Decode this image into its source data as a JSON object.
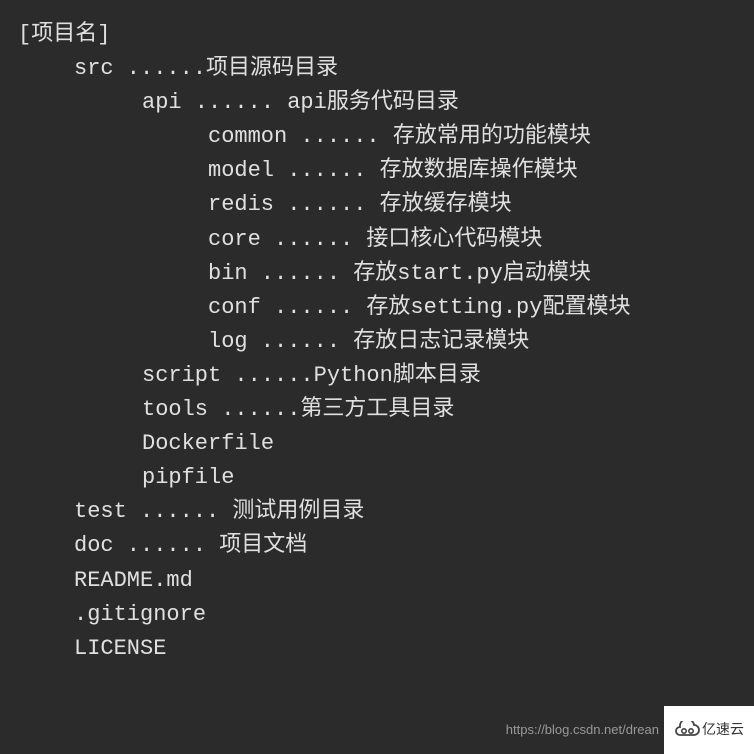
{
  "tree": {
    "root": "[项目名]",
    "lines": [
      {
        "indent": 1,
        "text": "src ......项目源码目录"
      },
      {
        "indent": 2,
        "text": "api ...... api服务代码目录"
      },
      {
        "indent": 3,
        "text": "common ...... 存放常用的功能模块"
      },
      {
        "indent": 3,
        "text": "model ...... 存放数据库操作模块"
      },
      {
        "indent": 3,
        "text": "redis ...... 存放缓存模块"
      },
      {
        "indent": 3,
        "text": "core ...... 接口核心代码模块"
      },
      {
        "indent": 3,
        "text": "bin ...... 存放start.py启动模块"
      },
      {
        "indent": 3,
        "text": "conf ...... 存放setting.py配置模块"
      },
      {
        "indent": 3,
        "text": "log ...... 存放日志记录模块"
      },
      {
        "indent": 2,
        "text": "script ......Python脚本目录"
      },
      {
        "indent": 2,
        "text": "tools ......第三方工具目录"
      },
      {
        "indent": 2,
        "text": "Dockerfile"
      },
      {
        "indent": 2,
        "text": "pipfile"
      },
      {
        "indent": 1,
        "text": "test ...... 测试用例目录"
      },
      {
        "indent": 1,
        "text": "doc ...... 项目文档"
      },
      {
        "indent": 1,
        "text": "README.md"
      },
      {
        "indent": 1,
        "text": ".gitignore"
      },
      {
        "indent": 1,
        "text": "LICENSE"
      }
    ]
  },
  "watermark": {
    "url": "https://blog.csdn.net/drean",
    "logo_text": "亿速云"
  }
}
